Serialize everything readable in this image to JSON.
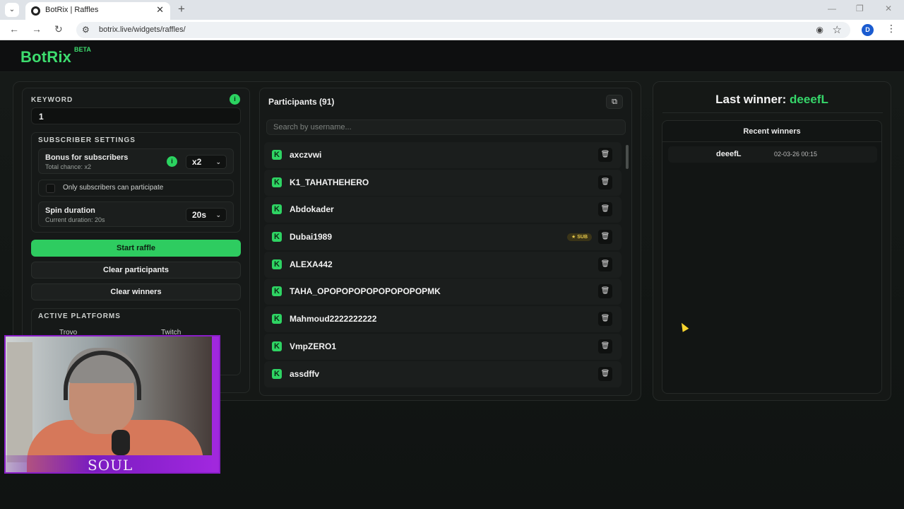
{
  "browser": {
    "tab_title": "BotRix | Raffles",
    "tab_close": "✕",
    "new_tab": "+",
    "url": "botrix.live/widgets/raffles/",
    "profile_initial": "D",
    "win_minimize": "—",
    "win_restore": "❐",
    "win_close": "✕"
  },
  "app": {
    "logo": "BotRix",
    "logo_badge": "BETA"
  },
  "settings": {
    "keyword_label": "KEYWORD",
    "keyword_value": "1",
    "subscriber_settings_label": "SUBSCRIBER SETTINGS",
    "bonus_title": "Bonus for subscribers",
    "bonus_sub": "Total chance: x2",
    "bonus_value": "x2",
    "only_subs_label": "Only subscribers can participate",
    "spin_title": "Spin duration",
    "spin_sub": "Current duration: 20s",
    "spin_value": "20s",
    "info_glyph": "i",
    "start_button": "Start raffle",
    "clear_participants_button": "Clear participants",
    "clear_winners_button": "Clear winners",
    "active_platforms_label": "ACTIVE PLATFORMS",
    "platforms": [
      "Trovo",
      "Twitch"
    ]
  },
  "participants": {
    "title": "Participants (91)",
    "search_placeholder": "Search by username...",
    "sub_badge": "SUB",
    "list": [
      {
        "name": "axczvwi",
        "sub": false
      },
      {
        "name": "K1_TAHATHEHERO",
        "sub": false
      },
      {
        "name": "Abdokader",
        "sub": false
      },
      {
        "name": "Dubai1989",
        "sub": true
      },
      {
        "name": "ALEXA442",
        "sub": false
      },
      {
        "name": "TAHA_OPOPOPOPOPOPOPOPOPMK",
        "sub": false
      },
      {
        "name": "Mahmoud2222222222",
        "sub": false
      },
      {
        "name": "VmpZERO1",
        "sub": false
      },
      {
        "name": "assdffv",
        "sub": false
      }
    ]
  },
  "winners": {
    "last_winner_prefix": "Last winner:",
    "last_winner_name": "deeefL",
    "recent_title": "Recent winners",
    "recent": [
      {
        "name": "deeefL",
        "date": "02-03-26 00:15"
      }
    ]
  },
  "webcam": {
    "overlay_name": "SOUL"
  },
  "colors": {
    "accent": "#2ecc60",
    "webcam_frame": "#a128dd"
  }
}
